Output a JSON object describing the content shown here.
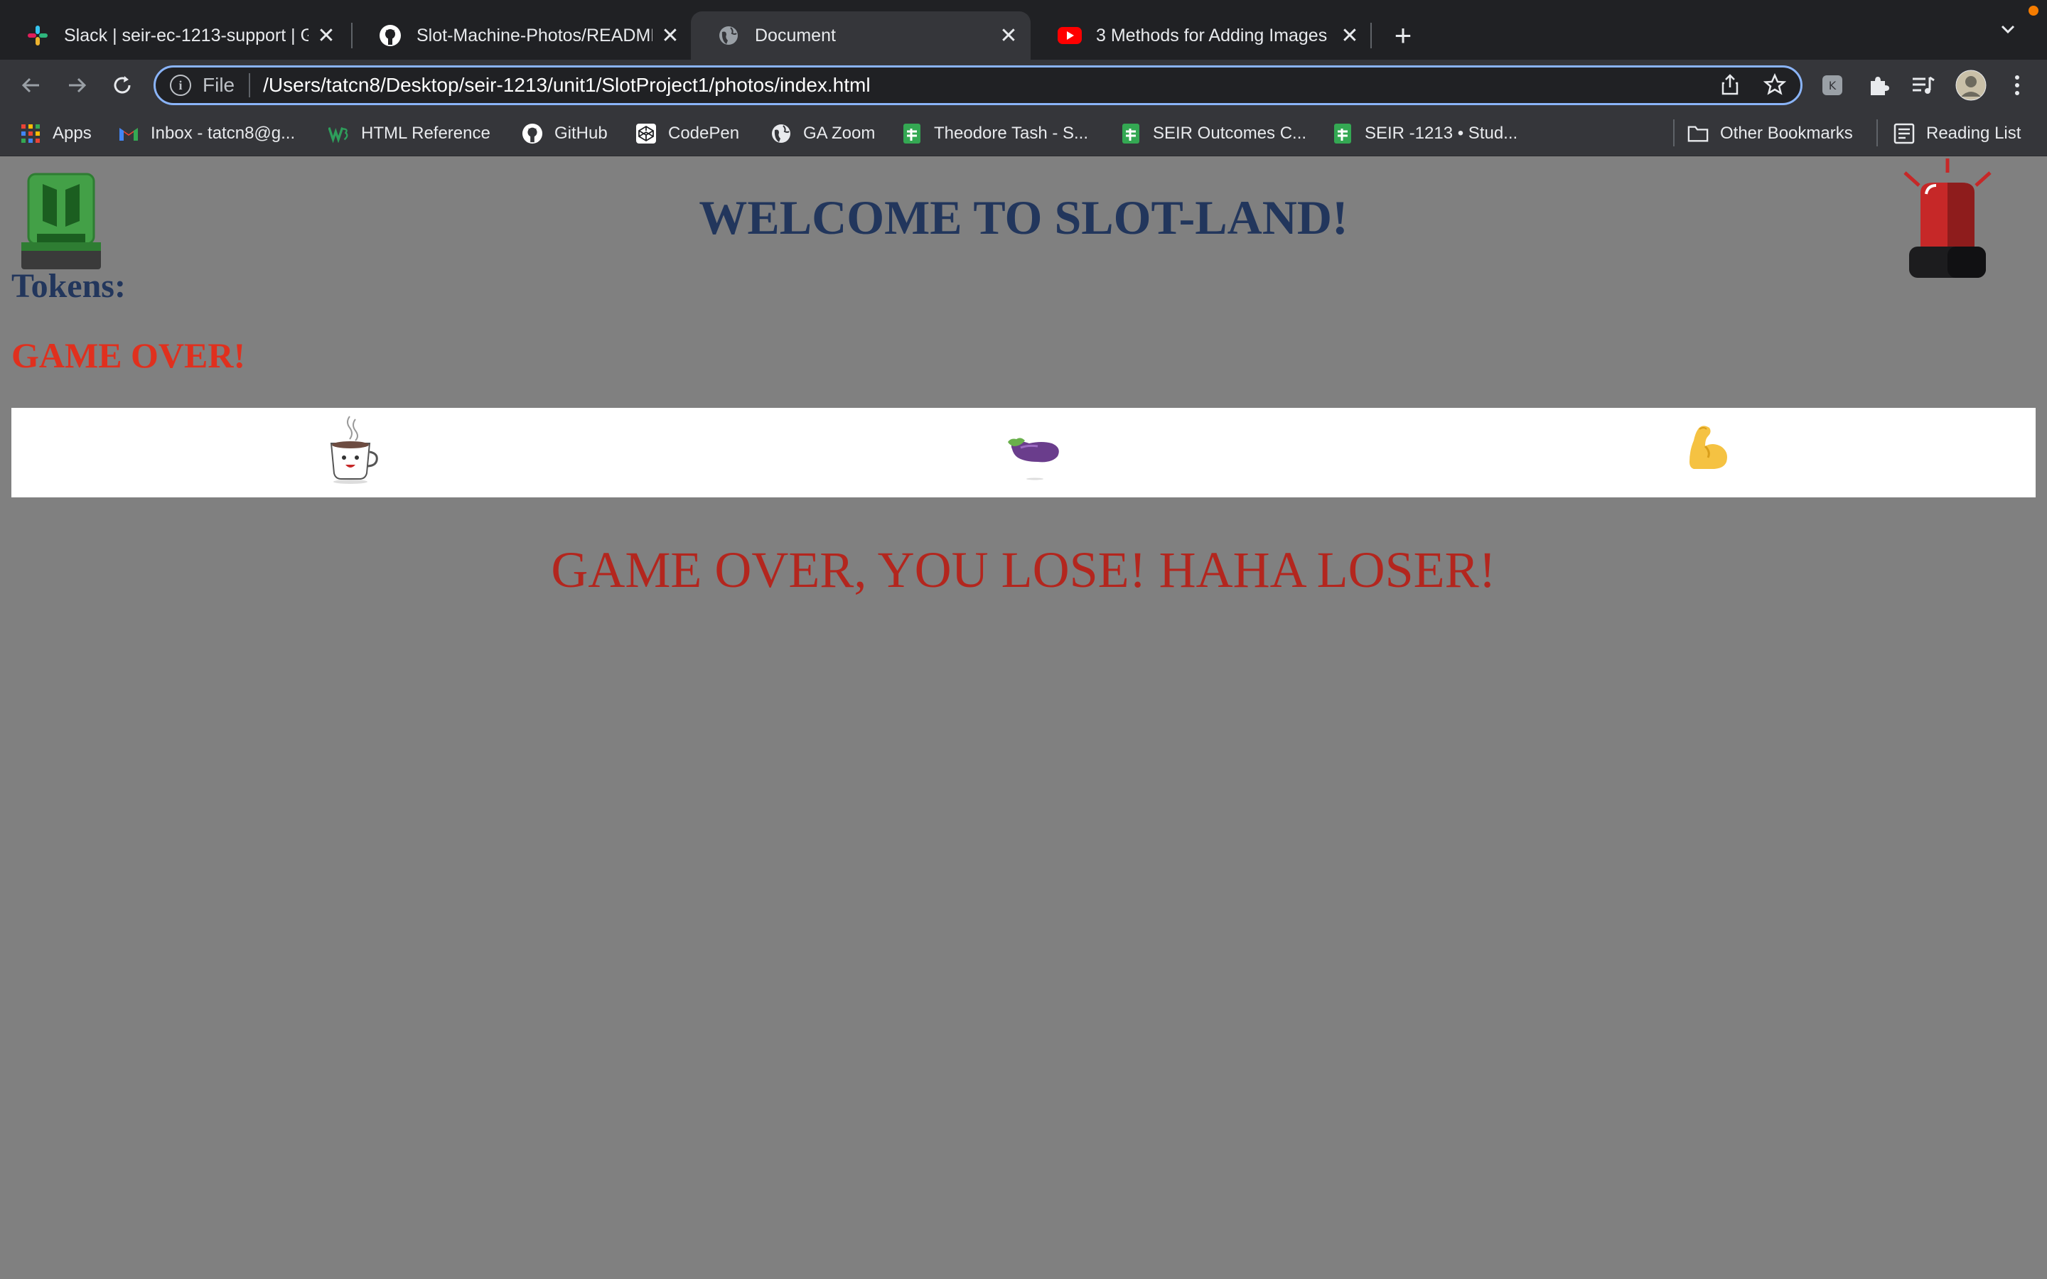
{
  "browser": {
    "tabs": [
      {
        "title": "Slack | seir-ec-1213-support | G",
        "icon": "slack-icon",
        "active": false
      },
      {
        "title": "Slot-Machine-Photos/README",
        "icon": "github-icon",
        "active": false
      },
      {
        "title": "Document",
        "icon": "globe-icon",
        "active": true
      },
      {
        "title": "3 Methods for Adding Images t",
        "icon": "youtube-icon",
        "active": false
      }
    ],
    "address": {
      "scheme": "File",
      "url": "/Users/tatcn8/Desktop/seir-1213/unit1/SlotProject1/photos/index.html"
    },
    "bookmarks": [
      {
        "label": "Apps",
        "icon": "apps-grid-icon"
      },
      {
        "label": "Inbox - tatcn8@g...",
        "icon": "gmail-icon"
      },
      {
        "label": "HTML Reference",
        "icon": "w3-icon"
      },
      {
        "label": "GitHub",
        "icon": "github-icon"
      },
      {
        "label": "CodePen",
        "icon": "codepen-icon"
      },
      {
        "label": "GA Zoom",
        "icon": "globe-icon"
      },
      {
        "label": "Theodore Tash - S...",
        "icon": "sheets-icon"
      },
      {
        "label": "SEIR Outcomes C...",
        "icon": "sheets-icon"
      },
      {
        "label": "SEIR -1213 • Stud...",
        "icon": "sheets-icon"
      },
      {
        "label": "Other Bookmarks",
        "icon": "folder-icon"
      },
      {
        "label": "Reading List",
        "icon": "reading-list-icon"
      }
    ]
  },
  "page": {
    "heading": "WELCOME TO SLOT-LAND!",
    "tokens_label": "Tokens:",
    "status_small": "GAME OVER!",
    "slots": [
      {
        "symbol": "coffee-cup-icon"
      },
      {
        "symbol": "eggplant-icon"
      },
      {
        "symbol": "flexed-biceps-icon"
      }
    ],
    "result_message": "GAME OVER, YOU LOSE! HAHA LOSER!"
  },
  "colors": {
    "page_bg": "#808080",
    "heading": "#22365c",
    "status_small": "#e0301e",
    "result_message": "#b3261e",
    "slots_bg": "#ffffff"
  }
}
